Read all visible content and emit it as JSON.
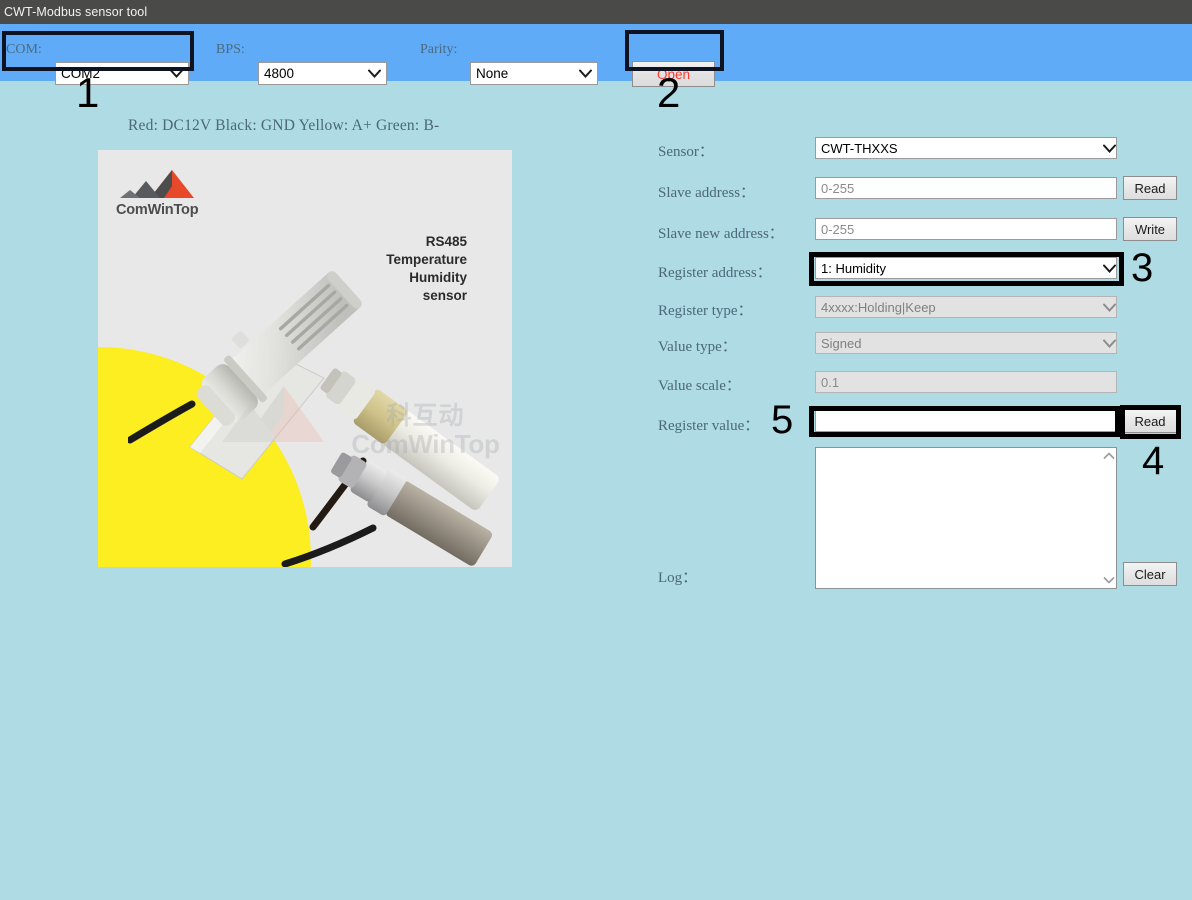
{
  "window": {
    "title": "CWT-Modbus sensor tool"
  },
  "toolbar": {
    "com": {
      "label": "COM:",
      "value": "COM2",
      "icon": "chevron-down-icon"
    },
    "bps": {
      "label": "BPS:",
      "value": "4800",
      "icon": "chevron-down-icon"
    },
    "parity": {
      "label": "Parity:",
      "value": "None",
      "icon": "chevron-down-icon"
    },
    "open_button": {
      "label": "Open",
      "color": "#ff3b30"
    }
  },
  "wiring_note": "Red: DC12V  Black: GND  Yellow: A+  Green: B-",
  "product_image": {
    "logo_text": "ComWinTop",
    "logo_colors": {
      "orange": "#e8492b",
      "gray": "#4d4d4d"
    },
    "caption_lines": [
      "RS485",
      "Temperature",
      "Humidity",
      "sensor"
    ],
    "watermark_cn": "科互动",
    "watermark_en": "ComWinTop",
    "accent_yellow": "#fcee21",
    "background": "#e8e8e8"
  },
  "form": {
    "sensor": {
      "label": "Sensor：",
      "value": "CWT-THXXS",
      "icon": "chevron-down-icon"
    },
    "slave_address": {
      "label": "Slave address：",
      "placeholder": "0-255",
      "value": "",
      "button": "Read"
    },
    "slave_new_address": {
      "label": "Slave new address：",
      "placeholder": "0-255",
      "value": "",
      "button": "Write"
    },
    "register_address": {
      "label": "Register address：",
      "value": "1: Humidity",
      "icon": "chevron-down-icon"
    },
    "register_type": {
      "label": "Register type：",
      "value": "4xxxx:Holding|Keep",
      "icon": "chevron-down-icon",
      "disabled": true
    },
    "value_type": {
      "label": "Value type：",
      "value": "Signed",
      "icon": "chevron-down-icon",
      "disabled": true
    },
    "value_scale": {
      "label": "Value scale：",
      "value": "0.1",
      "disabled": true
    },
    "register_value": {
      "label": "Register value：",
      "value": "",
      "button": "Read"
    },
    "log": {
      "label": "Log：",
      "value": "",
      "button": "Clear"
    }
  },
  "annotations": {
    "items": [
      {
        "number": "1",
        "target": "com-selector"
      },
      {
        "number": "2",
        "target": "open-button"
      },
      {
        "number": "3",
        "target": "register-address-selector"
      },
      {
        "number": "4",
        "target": "register-value-read-button"
      },
      {
        "number": "5",
        "target": "register-value-input"
      }
    ],
    "color": "#000000"
  },
  "theme": {
    "titlebar": "#4a4a48",
    "toolbar": "#5fabf7",
    "body": "#aedbe4",
    "label_text": "#4c6878"
  }
}
